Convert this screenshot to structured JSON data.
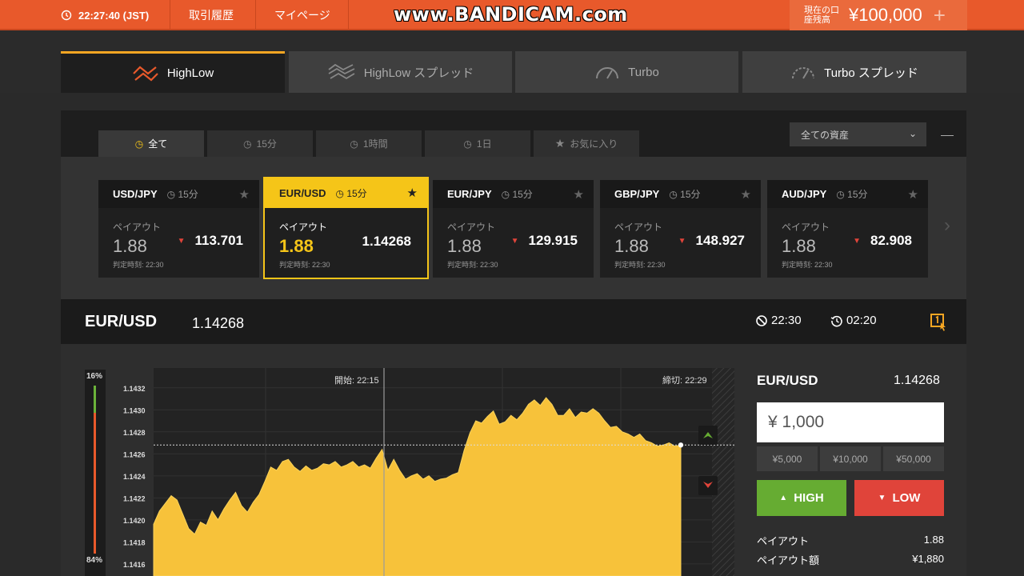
{
  "topbar": {
    "clock": "22:27:40 (JST)",
    "nav": [
      "取引履歴",
      "マイページ"
    ],
    "watermark": "www.BANDICAM.com",
    "balance_label": "現在の口座残高",
    "balance_amount": "¥100,000",
    "add_icon": "plus-icon"
  },
  "product_tabs": [
    {
      "label": "HighLow",
      "icon": "highlow-icon",
      "active": true
    },
    {
      "label": "HighLow スプレッド",
      "icon": "highlow-spread-icon",
      "active": false
    },
    {
      "label": "Turbo",
      "icon": "gauge-icon",
      "active": false
    },
    {
      "label": "Turbo スプレッド",
      "icon": "gauge-spread-icon",
      "active": false
    }
  ],
  "filters": {
    "tabs": [
      {
        "label": "全て",
        "icon": "clock-icon",
        "active": true
      },
      {
        "label": "15分",
        "icon": "clock-icon",
        "active": false
      },
      {
        "label": "1時間",
        "icon": "clock-icon",
        "active": false
      },
      {
        "label": "1日",
        "icon": "clock-icon",
        "active": false
      },
      {
        "label": "お気に入り",
        "icon": "star-icon",
        "active": false
      }
    ],
    "asset_select": "全ての資産"
  },
  "cards": [
    {
      "symbol": "USD/JPY",
      "duration": "15分",
      "payout_label": "ペイアウト",
      "payout": "1.88",
      "price": "113.701",
      "direction": "down",
      "expiry": "判定時刻: 22:30",
      "active": false
    },
    {
      "symbol": "EUR/USD",
      "duration": "15分",
      "payout_label": "ペイアウト",
      "payout": "1.88",
      "price": "1.14268",
      "direction": "none",
      "expiry": "判定時刻: 22:30",
      "active": true
    },
    {
      "symbol": "EUR/JPY",
      "duration": "15分",
      "payout_label": "ペイアウト",
      "payout": "1.88",
      "price": "129.915",
      "direction": "down",
      "expiry": "判定時刻: 22:30",
      "active": false
    },
    {
      "symbol": "GBP/JPY",
      "duration": "15分",
      "payout_label": "ペイアウト",
      "payout": "1.88",
      "price": "148.927",
      "direction": "down",
      "expiry": "判定時刻: 22:30",
      "active": false
    },
    {
      "symbol": "AUD/JPY",
      "duration": "15分",
      "payout_label": "ペイアウト",
      "payout": "1.88",
      "price": "82.908",
      "direction": "down",
      "expiry": "判定時刻: 22:30",
      "active": false
    }
  ],
  "asset_header": {
    "symbol": "EUR/USD",
    "price": "1.14268",
    "expiry_time": "22:30",
    "remaining": "02:20"
  },
  "sentiment": {
    "high_pct": "16%",
    "low_pct": "84%",
    "high": 0.16,
    "low": 0.84
  },
  "chart_data": {
    "type": "area",
    "annotations": {
      "start": "開始: 22:15",
      "close": "締切: 22:29"
    },
    "y_ticks": [
      "1.1432",
      "1.1430",
      "1.1428",
      "1.1426",
      "1.1424",
      "1.1422",
      "1.1420",
      "1.1418",
      "1.1416"
    ],
    "ylim": [
      1.14149,
      1.14338
    ],
    "current_price": 1.14268,
    "grid": true,
    "values": [
      1.14196,
      1.14208,
      1.14215,
      1.14222,
      1.14218,
      1.14205,
      1.14192,
      1.14187,
      1.14198,
      1.14195,
      1.14208,
      1.142,
      1.1421,
      1.14218,
      1.14225,
      1.14213,
      1.14207,
      1.14216,
      1.14223,
      1.14235,
      1.14248,
      1.14245,
      1.14253,
      1.14255,
      1.14248,
      1.14244,
      1.14249,
      1.14245,
      1.14247,
      1.14251,
      1.1425,
      1.14253,
      1.14248,
      1.1425,
      1.14253,
      1.14248,
      1.1425,
      1.14247,
      1.14256,
      1.14264,
      1.14245,
      1.14255,
      1.14245,
      1.14237,
      1.1424,
      1.14242,
      1.14237,
      1.1424,
      1.14235,
      1.14237,
      1.14238,
      1.14241,
      1.14243,
      1.14263,
      1.14279,
      1.1429,
      1.14288,
      1.14294,
      1.14299,
      1.14287,
      1.14289,
      1.14295,
      1.14291,
      1.14297,
      1.14305,
      1.14309,
      1.14304,
      1.14311,
      1.14305,
      1.14295,
      1.14295,
      1.14301,
      1.14293,
      1.14298,
      1.14297,
      1.14301,
      1.14297,
      1.1429,
      1.14284,
      1.14285,
      1.1428,
      1.14278,
      1.14275,
      1.14278,
      1.14272,
      1.1427,
      1.14267,
      1.14268,
      1.1427,
      1.14267,
      1.14268
    ]
  },
  "trade_panel": {
    "symbol": "EUR/USD",
    "price": "1.14268",
    "amount": "¥ 1,000",
    "quick_amounts": [
      "¥5,000",
      "¥10,000",
      "¥50,000"
    ],
    "high_label": "HIGH",
    "low_label": "LOW",
    "payout_label": "ペイアウト",
    "payout_value": "1.88",
    "payout_amount_label": "ペイアウト額",
    "payout_amount_value": "¥1,880"
  },
  "colors": {
    "accent": "#e8592b",
    "gold": "#f5c518",
    "high": "#66ac32",
    "low": "#e0443a"
  }
}
